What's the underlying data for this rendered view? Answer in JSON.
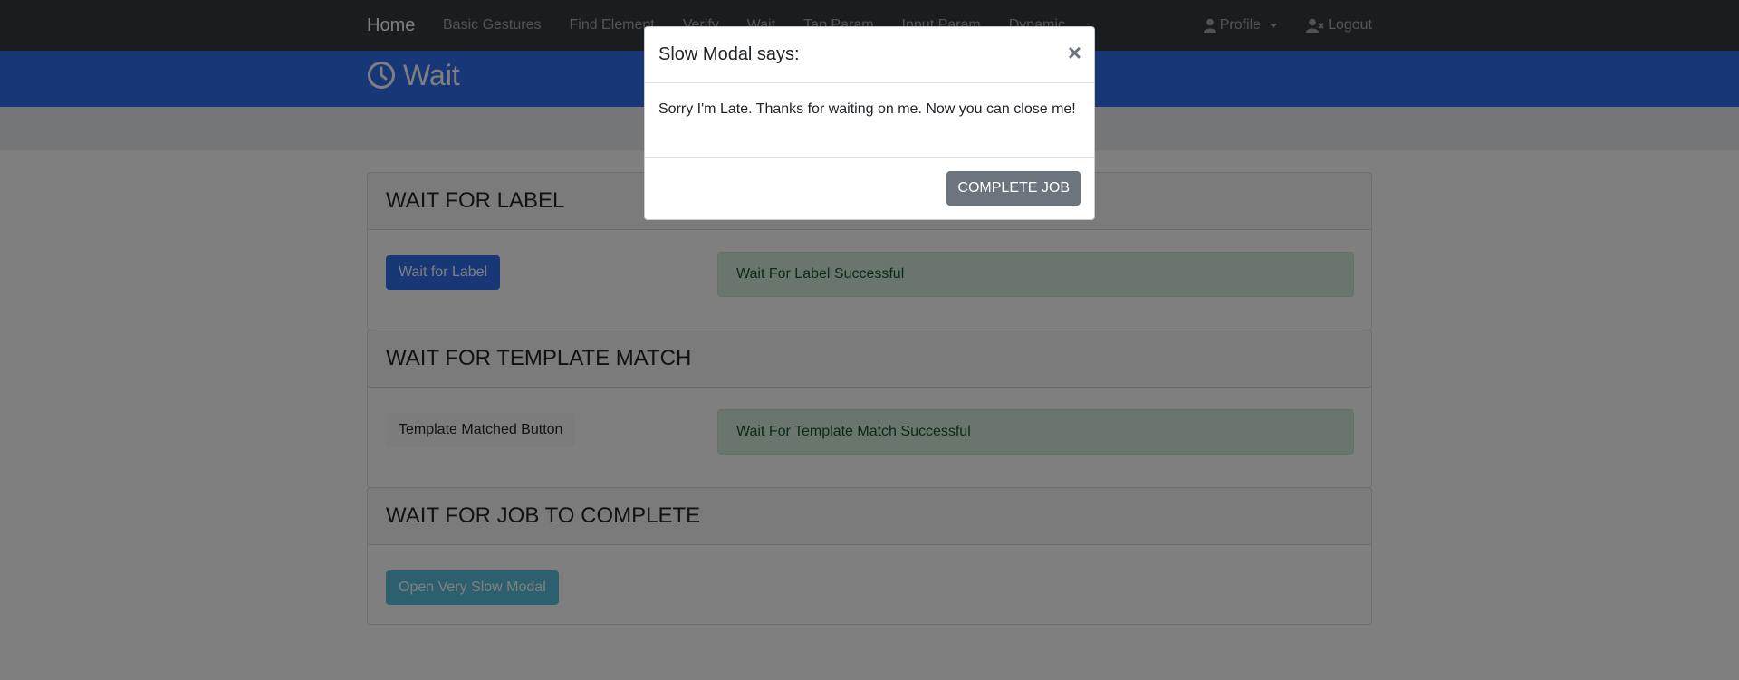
{
  "navbar": {
    "brand": "Home",
    "links": [
      "Basic Gestures",
      "Find Element",
      "Verify",
      "Wait",
      "Tap Param",
      "Input Param",
      "Dynamic"
    ],
    "profile_label": "Profile",
    "logout_label": "Logout"
  },
  "header": {
    "title": "Wait"
  },
  "cards": [
    {
      "title": "WAIT FOR LABEL",
      "button": "Wait for Label",
      "status": "Wait For Label Successful"
    },
    {
      "title": "WAIT FOR TEMPLATE MATCH",
      "button": "Template Matched Button",
      "status": "Wait For Template Match Successful"
    },
    {
      "title": "WAIT FOR JOB TO COMPLETE",
      "button": "Open Very Slow Modal"
    }
  ],
  "modal": {
    "title": "Slow Modal says:",
    "close": "×",
    "body": "Sorry I'm Late. Thanks for waiting on me. Now you can close me!",
    "action": "COMPLETE JOB"
  },
  "colors": {
    "navbar": "#343a40",
    "header": "#2f6fed",
    "primary": "#2f6fed",
    "info": "#5bc0de",
    "secondary": "#6c757d",
    "success_bg": "#d4edda"
  }
}
